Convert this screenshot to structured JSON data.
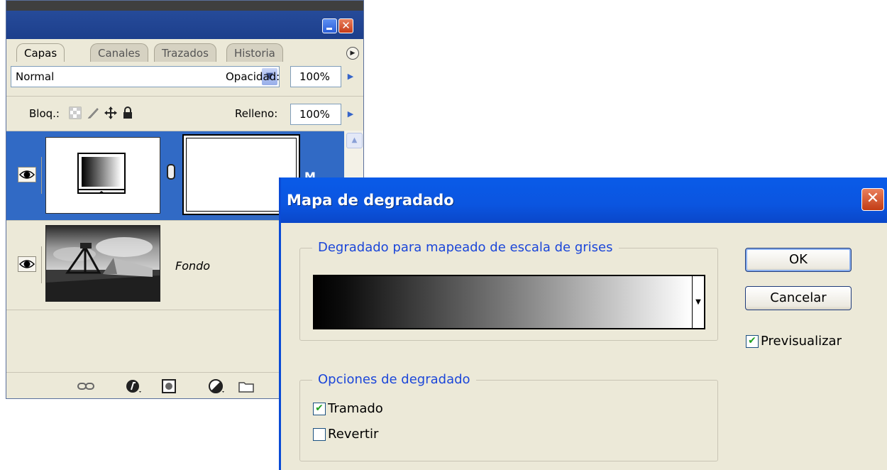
{
  "layers_panel": {
    "tabs": [
      "Capas",
      "Canales",
      "Trazados",
      "Historia"
    ],
    "blend_mode": "Normal",
    "opacity_label": "Opacidad:",
    "opacity_value": "100%",
    "lock_label": "Bloq.:",
    "fill_label": "Relleno:",
    "fill_value": "100%",
    "layers": [
      {
        "name": "",
        "type": "gradient-map-adjustment",
        "selected": true
      },
      {
        "name": "Fondo",
        "type": "image",
        "selected": false
      }
    ],
    "partial_text": "M"
  },
  "dialog": {
    "title": "Mapa de degradado",
    "gradient_group_label": "Degradado para mapeado de escala de grises",
    "options_group_label": "Opciones de degradado",
    "ok_label": "OK",
    "cancel_label": "Cancelar",
    "preview_label": "Previsualizar",
    "preview_checked": true,
    "dither_label": "Tramado",
    "dither_checked": true,
    "reverse_label": "Revertir",
    "reverse_checked": false
  },
  "colors": {
    "xp_titlebar": "#0a5be8",
    "selection_blue": "#316ac5",
    "dialog_bg": "#ece9d8",
    "group_label": "#1b46d9",
    "close_red": "#c23c15"
  }
}
